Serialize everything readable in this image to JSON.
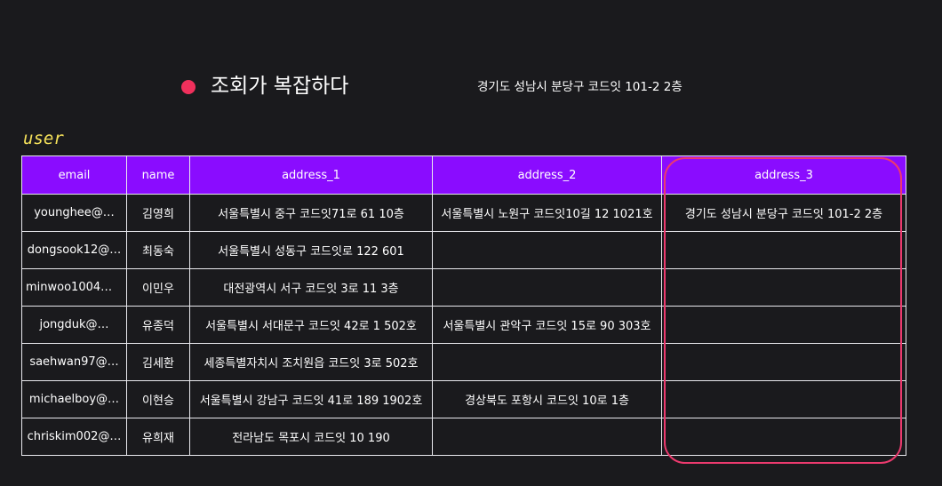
{
  "header": {
    "headline": "조회가 복잡하다",
    "address_note": "경기도 성남시 분당구 코드잇 101-2 2층"
  },
  "table_label": "user",
  "colors": {
    "bullet": "#f0305c",
    "header_bg": "#8a0cff",
    "highlight": "#ec3a6e",
    "label": "#f5e15a",
    "background": "#1a1a1d"
  },
  "table": {
    "columns": [
      "email",
      "name",
      "address_1",
      "address_2",
      "address_3"
    ],
    "rows": [
      [
        "younghee@…",
        "김영희",
        "서울특별시 중구 코드잇71로 61 10층",
        "서울특별시 노원구 코드잇10길 12 1021호",
        "경기도 성남시 분당구 코드잇 101-2 2층"
      ],
      [
        "dongsook12@…",
        "최동숙",
        "서울특별시 성동구 코드잇로 122 601",
        "",
        ""
      ],
      [
        "minwoo1004@…",
        "이민우",
        "대전광역시 서구 코드잇 3로 11 3층",
        "",
        ""
      ],
      [
        "jongduk@…",
        "유종덕",
        "서울특별시 서대문구 코드잇 42로 1 502호",
        "서울특별시 관악구 코드잇 15로 90 303호",
        ""
      ],
      [
        "saehwan97@…",
        "김세환",
        "세종특별자치시 조치원읍 코드잇 3로 502호",
        "",
        ""
      ],
      [
        "michaelboy@…",
        "이현승",
        "서울특별시 강남구 코드잇 41로 189 1902호",
        "경상북도 포항시 코드잇 10로 1층",
        ""
      ],
      [
        "chriskim002@…",
        "유희재",
        "전라남도 목포시 코드잇 10 190",
        "",
        ""
      ]
    ]
  }
}
